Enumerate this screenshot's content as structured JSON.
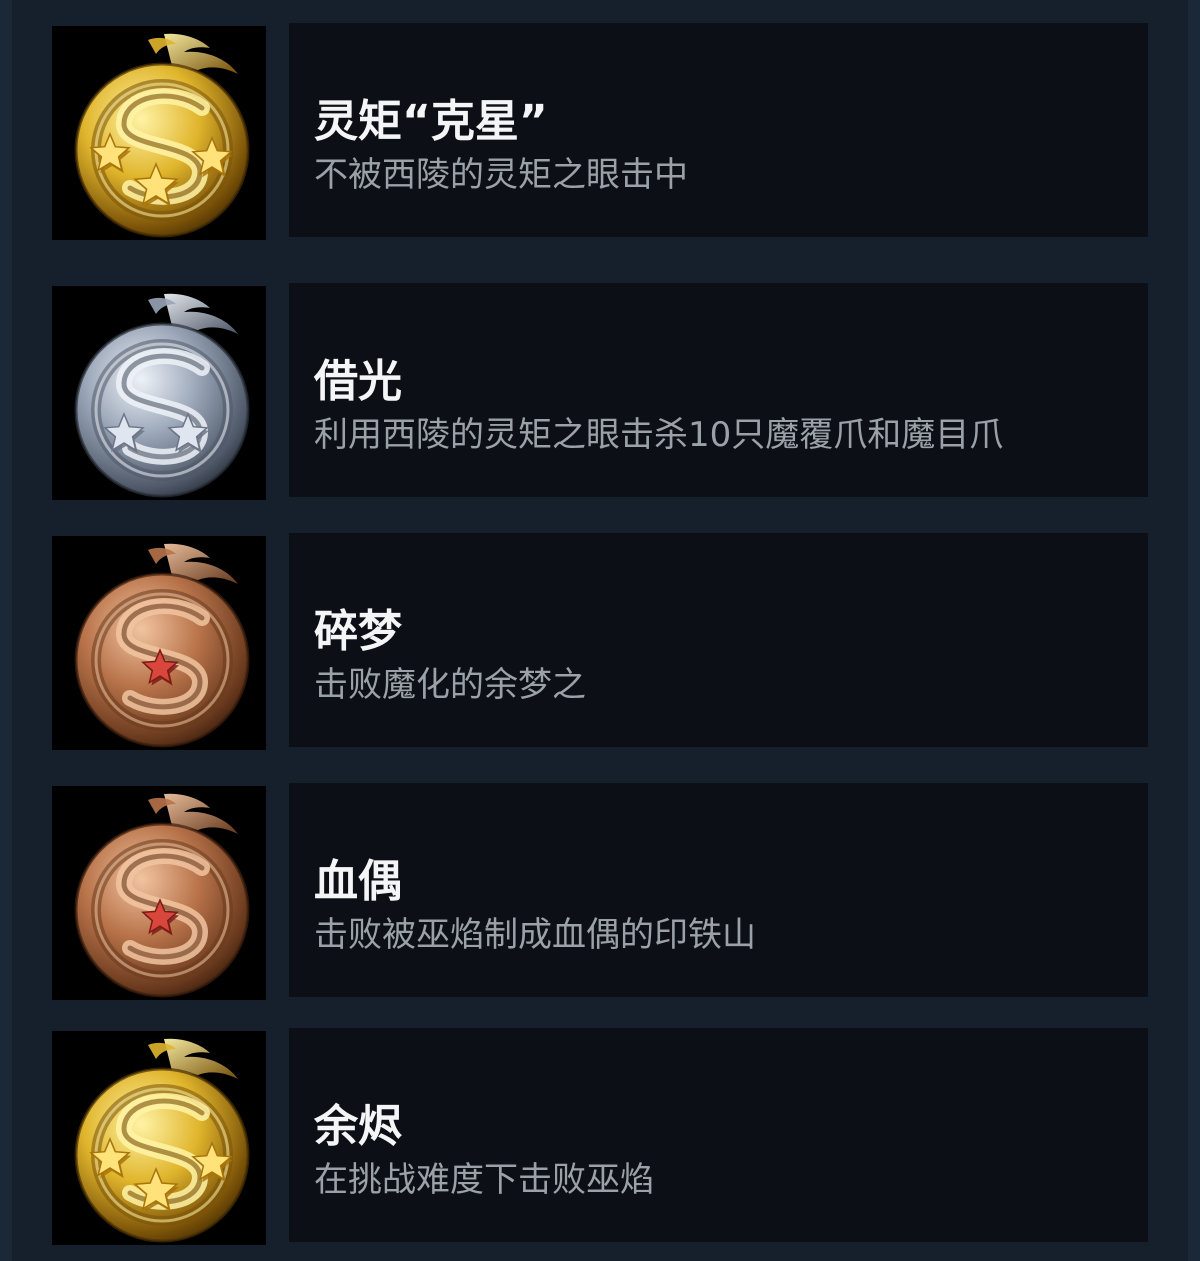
{
  "achievements": [
    {
      "title": "灵矩“克星”",
      "description": "不被西陵的灵矩之眼击中",
      "tier": "gold",
      "stars": 3,
      "icon": "gold-dragon-medal-icon"
    },
    {
      "title": "借光",
      "description": "利用西陵的灵矩之眼击杀10只魔覆爪和魔目爪",
      "tier": "silver",
      "stars": 2,
      "icon": "silver-dragon-medal-icon"
    },
    {
      "title": "碎梦",
      "description": "击败魔化的余梦之",
      "tier": "bronze",
      "stars": 1,
      "icon": "bronze-dragon-medal-icon"
    },
    {
      "title": "血偶",
      "description": "击败被巫焰制成血偶的印铁山",
      "tier": "bronze",
      "stars": 1,
      "icon": "bronze-dragon-medal-icon"
    },
    {
      "title": "余烬",
      "description": "在挑战难度下击败巫焰",
      "tier": "gold",
      "stars": 3,
      "icon": "gold-dragon-medal-icon"
    }
  ],
  "colors": {
    "page_background": "#1b2838",
    "panel_background": "#16202d",
    "card_background": "#0c0f15",
    "title_text": "#f4f5f6",
    "description_text": "#9aa1a9"
  }
}
